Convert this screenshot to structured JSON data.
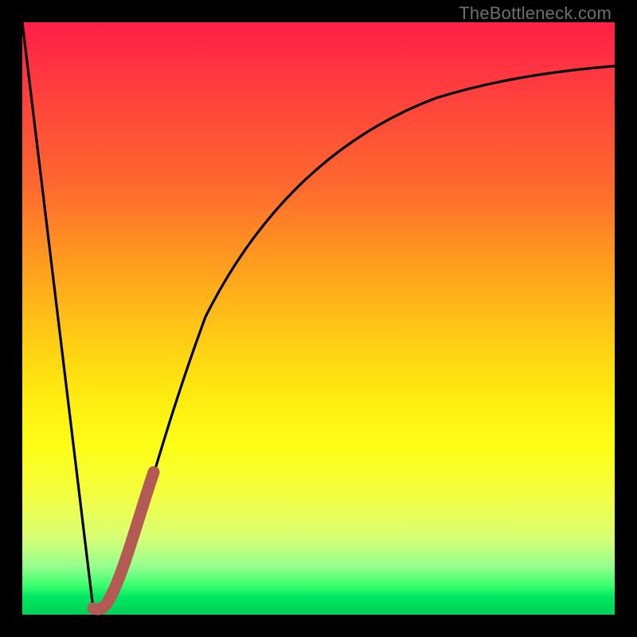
{
  "attribution": "TheBottleneck.com",
  "colors": {
    "background": "#000000",
    "gradient_top": "#ff1f47",
    "gradient_mid": "#ffe80f",
    "gradient_bottom": "#00cf57",
    "curve": "#000000",
    "highlight": "#b45a55"
  },
  "chart_data": {
    "type": "line",
    "title": "",
    "xlabel": "",
    "ylabel": "",
    "xlim": [
      0,
      100
    ],
    "ylim": [
      0,
      100
    ],
    "series": [
      {
        "name": "curve",
        "x": [
          0,
          12,
          13,
          14,
          16,
          18,
          21,
          25,
          30,
          36,
          44,
          54,
          66,
          80,
          100
        ],
        "y": [
          100,
          1,
          1.5,
          2,
          5,
          10,
          22,
          36,
          50,
          61,
          71,
          79,
          85,
          89,
          92
        ]
      },
      {
        "name": "highlight-segment",
        "x": [
          12,
          13,
          14,
          16,
          18,
          21
        ],
        "y": [
          1,
          1.5,
          2,
          5,
          10,
          22
        ]
      }
    ],
    "annotations": [
      {
        "text": "TheBottleneck.com",
        "position": "top-right"
      }
    ]
  }
}
